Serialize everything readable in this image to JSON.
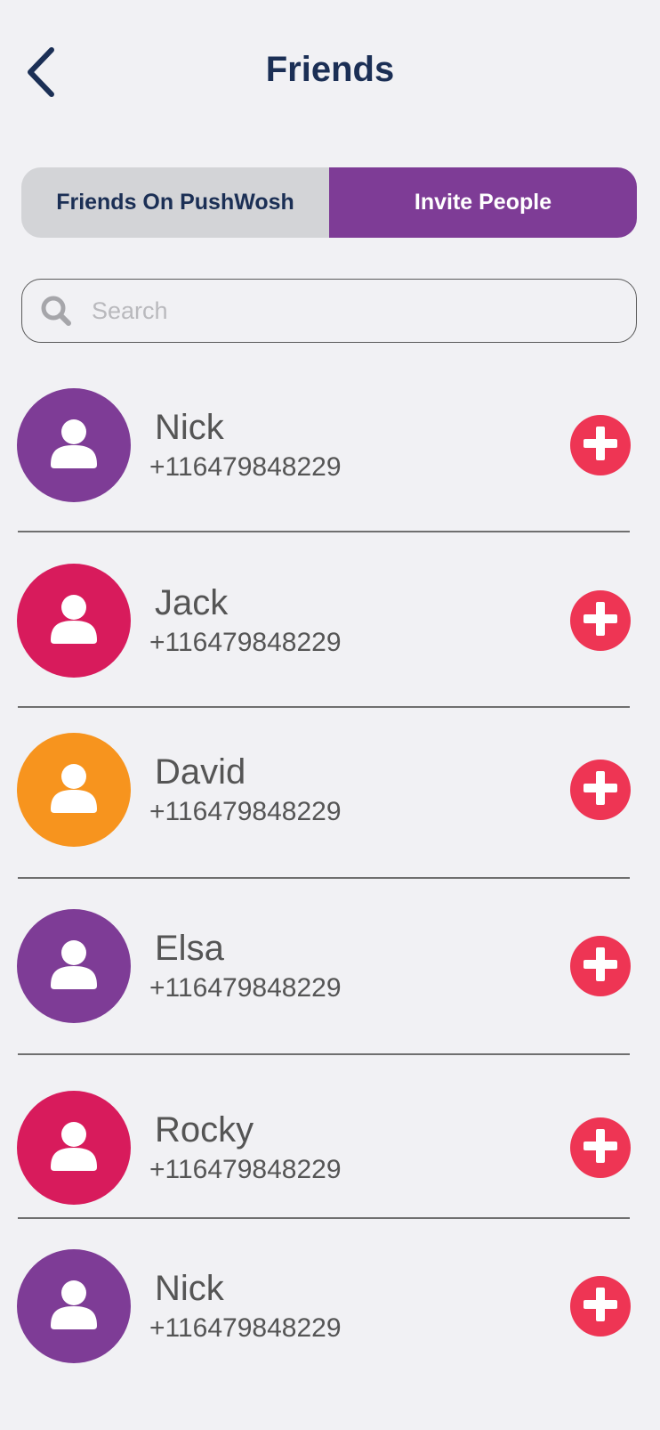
{
  "header": {
    "title": "Friends"
  },
  "tabs": [
    {
      "label": "Friends On PushWosh",
      "active": false
    },
    {
      "label": "Invite People",
      "active": true
    }
  ],
  "search": {
    "placeholder": "Search",
    "value": ""
  },
  "contacts": [
    {
      "name": "Nick",
      "phone": "+116479848229",
      "avatar_color": "#7e3c96"
    },
    {
      "name": "Jack",
      "phone": "+116479848229",
      "avatar_color": "#d81b5c"
    },
    {
      "name": "David",
      "phone": "+116479848229",
      "avatar_color": "#f7941e"
    },
    {
      "name": "Elsa",
      "phone": "+116479848229",
      "avatar_color": "#7e3c96"
    },
    {
      "name": "Rocky",
      "phone": "+116479848229",
      "avatar_color": "#d81b5c"
    },
    {
      "name": "Nick",
      "phone": "+116479848229",
      "avatar_color": "#7e3c96"
    }
  ],
  "icons": {
    "back": "chevron-left-icon",
    "search": "search-icon",
    "avatar": "user-icon",
    "add": "plus-icon"
  },
  "colors": {
    "accent": "#7e3c96",
    "add": "#ee3554",
    "title": "#1b2f55"
  }
}
